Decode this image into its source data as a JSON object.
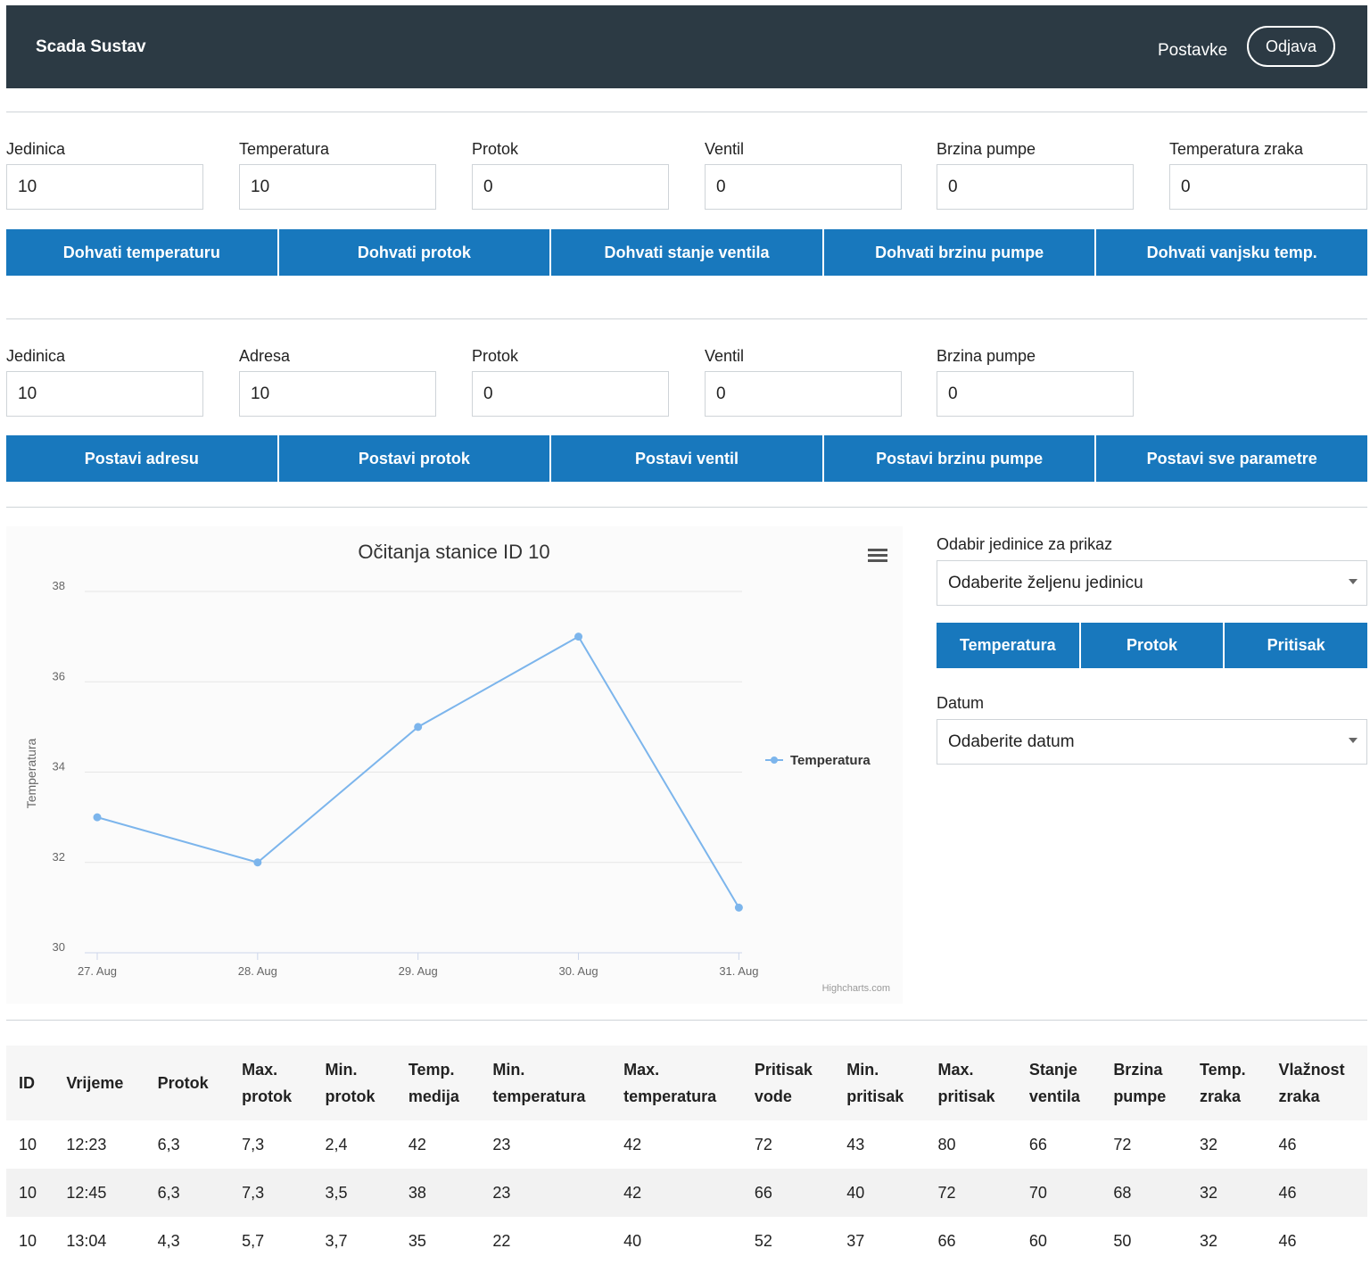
{
  "navbar": {
    "brand": "Scada Sustav",
    "settings": "Postavke",
    "logout": "Odjava"
  },
  "read_section": {
    "fields": [
      {
        "label": "Jedinica",
        "value": "10"
      },
      {
        "label": "Temperatura",
        "value": "10"
      },
      {
        "label": "Protok",
        "value": "0"
      },
      {
        "label": "Ventil",
        "value": "0"
      },
      {
        "label": "Brzina pumpe",
        "value": "0"
      },
      {
        "label": "Temperatura zraka",
        "value": "0"
      }
    ],
    "buttons": [
      "Dohvati temperaturu",
      "Dohvati protok",
      "Dohvati stanje ventila",
      "Dohvati brzinu pumpe",
      "Dohvati vanjsku temp."
    ]
  },
  "write_section": {
    "fields": [
      {
        "label": "Jedinica",
        "value": "10"
      },
      {
        "label": "Adresa",
        "value": "10"
      },
      {
        "label": "Protok",
        "value": "0"
      },
      {
        "label": "Ventil",
        "value": "0"
      },
      {
        "label": "Brzina pumpe",
        "value": "0"
      }
    ],
    "buttons": [
      "Postavi adresu",
      "Postavi protok",
      "Postavi ventil",
      "Postavi brzinu pumpe",
      "Postavi sve parametre"
    ]
  },
  "side_panel": {
    "unit_label": "Odabir jedinice za prikaz",
    "unit_select": "Odaberite željenu jedinicu",
    "metric_buttons": [
      "Temperatura",
      "Protok",
      "Pritisak"
    ],
    "date_label": "Datum",
    "date_select": "Odaberite datum"
  },
  "chart_credit": "Highcharts.com",
  "chart_data": {
    "type": "line",
    "title": "Očitanja stanice ID 10",
    "xlabel": "",
    "ylabel": "Temperatura",
    "categories": [
      "27. Aug",
      "28. Aug",
      "29. Aug",
      "30. Aug",
      "31. Aug"
    ],
    "series": [
      {
        "name": "Temperatura",
        "values": [
          33,
          32,
          35,
          37,
          31
        ],
        "color": "#7cb5ec"
      }
    ],
    "yticks": [
      "30",
      "32",
      "34",
      "36",
      "38"
    ],
    "ylim": [
      30,
      38
    ],
    "grid": true,
    "legend": "right"
  },
  "table": {
    "headers": [
      [
        "ID"
      ],
      [
        "Vrijeme"
      ],
      [
        "Protok"
      ],
      [
        "Max.",
        "protok"
      ],
      [
        "Min.",
        "protok"
      ],
      [
        "Temp.",
        "medija"
      ],
      [
        "Min.",
        "temperatura"
      ],
      [
        "Max.",
        "temperatura"
      ],
      [
        "Pritisak",
        "vode"
      ],
      [
        "Min.",
        "pritisak"
      ],
      [
        "Max.",
        "pritisak"
      ],
      [
        "Stanje",
        "ventila"
      ],
      [
        "Brzina",
        "pumpe"
      ],
      [
        "Temp.",
        "zraka"
      ],
      [
        "Vlažnost",
        "zraka"
      ]
    ],
    "rows": [
      [
        "10",
        "12:23",
        "6,3",
        "7,3",
        "2,4",
        "42",
        "23",
        "42",
        "72",
        "43",
        "80",
        "66",
        "72",
        "32",
        "46"
      ],
      [
        "10",
        "12:45",
        "6,3",
        "7,3",
        "3,5",
        "38",
        "23",
        "42",
        "66",
        "40",
        "72",
        "70",
        "68",
        "32",
        "46"
      ],
      [
        "10",
        "13:04",
        "4,3",
        "5,7",
        "3,7",
        "35",
        "22",
        "40",
        "52",
        "37",
        "66",
        "60",
        "50",
        "32",
        "46"
      ]
    ]
  }
}
